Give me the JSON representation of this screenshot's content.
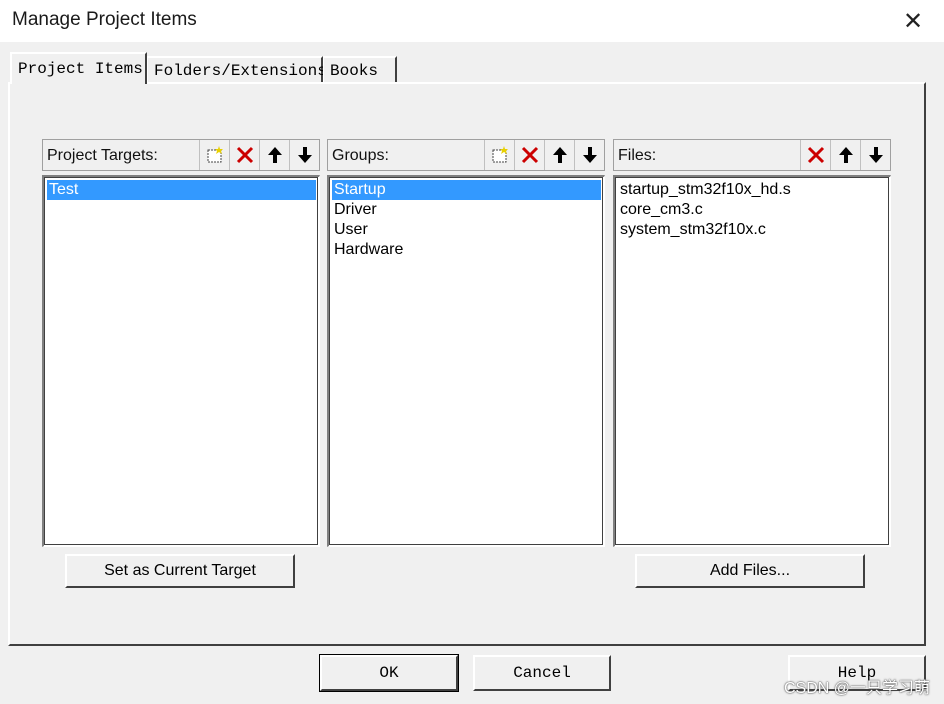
{
  "window": {
    "title": "Manage Project Items",
    "close_glyph": "✕"
  },
  "tabs": [
    {
      "label": "Project Items",
      "active": true
    },
    {
      "label": "Folders/Extensions",
      "active": false
    },
    {
      "label": "Books",
      "active": false
    }
  ],
  "panels": {
    "targets": {
      "label": "Project Targets:",
      "tools": [
        "new-icon",
        "delete-icon",
        "move-up-icon",
        "move-down-icon"
      ],
      "items": [
        "Test"
      ],
      "selected": "Test"
    },
    "groups": {
      "label": "Groups:",
      "tools": [
        "new-icon",
        "delete-icon",
        "move-up-icon",
        "move-down-icon"
      ],
      "items": [
        "Startup",
        "Driver",
        "User",
        "Hardware"
      ],
      "selected": "Startup"
    },
    "files": {
      "label": "Files:",
      "tools": [
        "delete-icon",
        "move-up-icon",
        "move-down-icon"
      ],
      "items": [
        "startup_stm32f10x_hd.s",
        "core_cm3.c",
        "system_stm32f10x.c"
      ],
      "selected": null
    }
  },
  "buttons": {
    "set_target": "Set as Current Target",
    "add_files": "Add Files...",
    "ok": "OK",
    "cancel": "Cancel",
    "help": "Help"
  },
  "colors": {
    "selection": "#3399ff",
    "delete": "#cc0000",
    "new_icon": "#e8d000"
  },
  "watermark": "CSDN @一只学习萌"
}
